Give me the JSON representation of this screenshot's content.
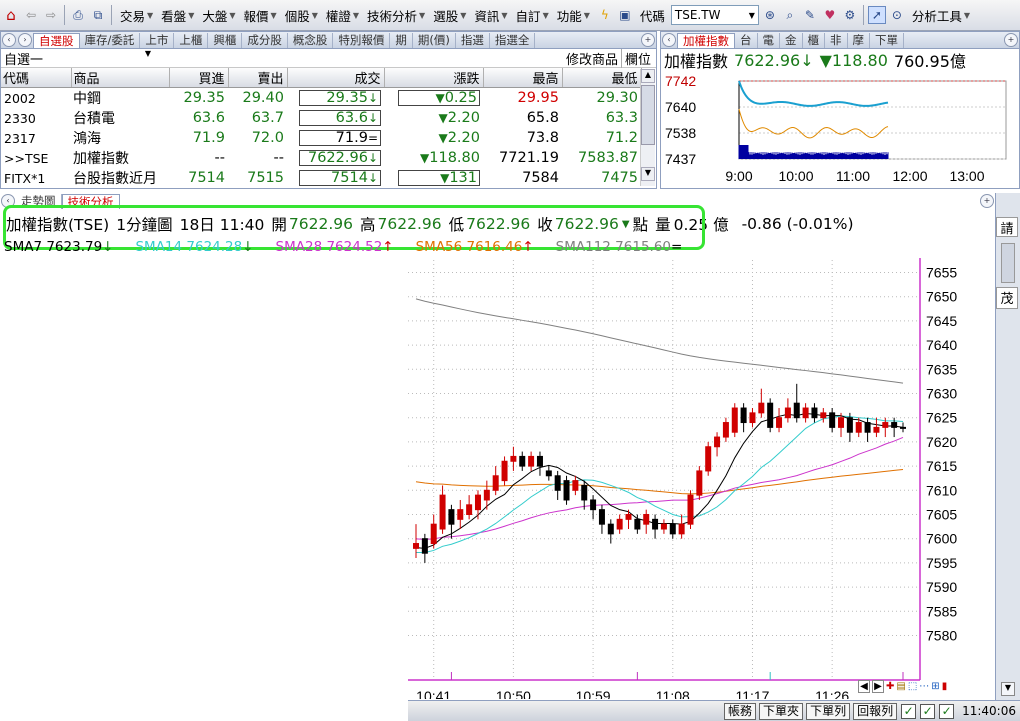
{
  "toolbar": {
    "menus": [
      "交易",
      "看盤",
      "大盤",
      "報價",
      "個股",
      "權證",
      "技術分析",
      "選股",
      "資訊",
      "自訂",
      "功能"
    ],
    "code_label": "代碼",
    "code_value": "TSE.TW",
    "analysis_tools": "分析工具"
  },
  "watchlist": {
    "tabs": [
      "自選股",
      "庫存/委託",
      "上市",
      "上櫃",
      "興櫃",
      "成分股",
      "概念股",
      "特別報價",
      "期",
      "期(價)",
      "指選",
      "指選全"
    ],
    "active_tab": "自選股",
    "list_name": "自選一",
    "edit_label": "修改商品",
    "field_label": "欄位",
    "columns": [
      "代碼",
      "商品",
      "買進",
      "賣出",
      "成交",
      "漲跌",
      "最高",
      "最低"
    ],
    "rows": [
      {
        "code": "2002",
        "name": "中鋼",
        "bid": "29.35",
        "ask": "29.40",
        "last": "29.35",
        "last_mark": "↓",
        "chg": "0.25",
        "chg_dir": "▼",
        "high": "29.95",
        "low": "29.30"
      },
      {
        "code": "2330",
        "name": "台積電",
        "bid": "63.6",
        "ask": "63.7",
        "last": "63.6",
        "last_mark": "↓",
        "chg": "2.20",
        "chg_dir": "▼",
        "high": "65.8",
        "low": "63.3"
      },
      {
        "code": "2317",
        "name": "鴻海",
        "bid": "71.9",
        "ask": "72.0",
        "last": "71.9",
        "last_mark": "=",
        "chg": "2.20",
        "chg_dir": "▼",
        "high": "73.8",
        "low": "71.2"
      },
      {
        "code": ">>TSE",
        "name": "加權指數",
        "bid": "--",
        "ask": "--",
        "last": "7622.96",
        "last_mark": "↓",
        "chg": "118.80",
        "chg_dir": "▼",
        "high": "7721.19",
        "low": "7583.87"
      },
      {
        "code": "FITX*1",
        "name": "台股指數近月",
        "bid": "7514",
        "ask": "7515",
        "last": "7514",
        "last_mark": "↓",
        "chg": "131",
        "chg_dir": "▼",
        "high": "7584",
        "low": "7475"
      }
    ]
  },
  "mini_chart": {
    "tabs": [
      "加權指數",
      "台",
      "電",
      "金",
      "櫃",
      "非",
      "摩",
      "下單"
    ],
    "active_tab": "加權指數",
    "title": "加權指數",
    "price": "7622.96",
    "price_mark": "↓",
    "change_mark": "▼",
    "change": "118.80",
    "volume": "760.95億",
    "y_ticks": [
      "7742",
      "7640",
      "7538",
      "7437"
    ],
    "x_ticks": [
      "9:00",
      "10:00",
      "11:00",
      "12:00",
      "13:00"
    ]
  },
  "main_chart": {
    "tabs": [
      "走勢圖",
      "技術分析"
    ],
    "active_tab": "技術分析",
    "quote": {
      "name": "加權指數(TSE)",
      "period": "1分鐘圖",
      "datetime": "18日 11:40",
      "open_label": "開",
      "open": "7622.96",
      "high_label": "高",
      "high": "7622.96",
      "low_label": "低",
      "low": "7622.96",
      "close_label": "收",
      "close": "7622.96",
      "close_mark": "▼",
      "unit_label": "點",
      "vol_label": "量",
      "volume": "0.25 億",
      "change": "-0.86 (-0.01%)"
    },
    "sma_legend": [
      {
        "label": "SMA7 7623.79",
        "mark": "↓",
        "color": "#000000"
      },
      {
        "label": "SMA14 7624.28",
        "mark": "↓",
        "color": "#33cccc"
      },
      {
        "label": "SMA28 7624.52",
        "mark": "↑",
        "color": "#cc33cc"
      },
      {
        "label": "SMA56 7616.46",
        "mark": "↑",
        "color": "#e07000"
      },
      {
        "label": "SMA112 7615.60",
        "mark": "=",
        "color": "#808080"
      }
    ]
  },
  "right_panel": {
    "label_top": "請",
    "label_mid": "茂"
  },
  "status_bar": {
    "buttons": [
      "帳務",
      "下單夾",
      "下單列",
      "回報列"
    ],
    "time": "11:40:06"
  },
  "colors": {
    "up": "#d00000",
    "down": "#1a7a1a",
    "highlight_box": "#37e433",
    "chart_frame": "#cc33cc"
  },
  "chart_data": {
    "type": "candlestick",
    "ylim": [
      7577,
      7658
    ],
    "y_ticks": [
      7655,
      7650,
      7645,
      7640,
      7635,
      7630,
      7625,
      7620,
      7615,
      7610,
      7605,
      7600,
      7595,
      7590,
      7585,
      7580
    ],
    "x_ticks": [
      "10:41",
      "10:50",
      "10:59",
      "11:08",
      "11:17",
      "11:26"
    ],
    "candles": [
      {
        "o": 7598,
        "c": 7599,
        "h": 7603,
        "l": 7596
      },
      {
        "o": 7600,
        "c": 7597,
        "h": 7601,
        "l": 7595
      },
      {
        "o": 7599,
        "c": 7603,
        "h": 7605,
        "l": 7598
      },
      {
        "o": 7602,
        "c": 7609,
        "h": 7611,
        "l": 7601
      },
      {
        "o": 7606,
        "c": 7603,
        "h": 7607,
        "l": 7600
      },
      {
        "o": 7604,
        "c": 7606,
        "h": 7608,
        "l": 7602
      },
      {
        "o": 7605,
        "c": 7607,
        "h": 7609,
        "l": 7604
      },
      {
        "o": 7606,
        "c": 7609,
        "h": 7610,
        "l": 7604
      },
      {
        "o": 7608,
        "c": 7610,
        "h": 7612,
        "l": 7606
      },
      {
        "o": 7610,
        "c": 7613,
        "h": 7615,
        "l": 7609
      },
      {
        "o": 7612,
        "c": 7616,
        "h": 7617,
        "l": 7611
      },
      {
        "o": 7616,
        "c": 7617,
        "h": 7619,
        "l": 7614
      },
      {
        "o": 7617,
        "c": 7615,
        "h": 7618,
        "l": 7614
      },
      {
        "o": 7615,
        "c": 7617,
        "h": 7618,
        "l": 7614
      },
      {
        "o": 7617,
        "c": 7615,
        "h": 7618,
        "l": 7613
      },
      {
        "o": 7614,
        "c": 7613,
        "h": 7615,
        "l": 7612
      },
      {
        "o": 7613,
        "c": 7610,
        "h": 7614,
        "l": 7608
      },
      {
        "o": 7612,
        "c": 7608,
        "h": 7613,
        "l": 7607
      },
      {
        "o": 7610,
        "c": 7612,
        "h": 7613,
        "l": 7609
      },
      {
        "o": 7611,
        "c": 7608,
        "h": 7612,
        "l": 7606
      },
      {
        "o": 7608,
        "c": 7606,
        "h": 7609,
        "l": 7604
      },
      {
        "o": 7606,
        "c": 7603,
        "h": 7607,
        "l": 7601
      },
      {
        "o": 7603,
        "c": 7601,
        "h": 7604,
        "l": 7599
      },
      {
        "o": 7602,
        "c": 7604,
        "h": 7605,
        "l": 7601
      },
      {
        "o": 7604,
        "c": 7605,
        "h": 7606,
        "l": 7602
      },
      {
        "o": 7604,
        "c": 7602,
        "h": 7605,
        "l": 7601
      },
      {
        "o": 7603,
        "c": 7605,
        "h": 7606,
        "l": 7601
      },
      {
        "o": 7604,
        "c": 7602,
        "h": 7605,
        "l": 7600
      },
      {
        "o": 7602,
        "c": 7603,
        "h": 7604,
        "l": 7601
      },
      {
        "o": 7603,
        "c": 7601,
        "h": 7604,
        "l": 7600
      },
      {
        "o": 7601,
        "c": 7603,
        "h": 7605,
        "l": 7600
      },
      {
        "o": 7603,
        "c": 7609,
        "h": 7610,
        "l": 7602
      },
      {
        "o": 7609,
        "c": 7614,
        "h": 7615,
        "l": 7608
      },
      {
        "o": 7614,
        "c": 7619,
        "h": 7620,
        "l": 7613
      },
      {
        "o": 7619,
        "c": 7621,
        "h": 7622,
        "l": 7617
      },
      {
        "o": 7621,
        "c": 7624,
        "h": 7625,
        "l": 7620
      },
      {
        "o": 7622,
        "c": 7627,
        "h": 7628,
        "l": 7621
      },
      {
        "o": 7627,
        "c": 7624,
        "h": 7628,
        "l": 7622
      },
      {
        "o": 7624,
        "c": 7626,
        "h": 7627,
        "l": 7623
      },
      {
        "o": 7626,
        "c": 7628,
        "h": 7631,
        "l": 7625
      },
      {
        "o": 7628,
        "c": 7623,
        "h": 7629,
        "l": 7622
      },
      {
        "o": 7623,
        "c": 7625,
        "h": 7627,
        "l": 7622
      },
      {
        "o": 7625,
        "c": 7627,
        "h": 7629,
        "l": 7624
      },
      {
        "o": 7628,
        "c": 7625,
        "h": 7632,
        "l": 7624
      },
      {
        "o": 7625,
        "c": 7627,
        "h": 7628,
        "l": 7624
      },
      {
        "o": 7627,
        "c": 7625,
        "h": 7628,
        "l": 7624
      },
      {
        "o": 7625,
        "c": 7626,
        "h": 7627,
        "l": 7624
      },
      {
        "o": 7626,
        "c": 7623,
        "h": 7627,
        "l": 7622
      },
      {
        "o": 7623,
        "c": 7625,
        "h": 7626,
        "l": 7621
      },
      {
        "o": 7625,
        "c": 7622,
        "h": 7626,
        "l": 7620
      },
      {
        "o": 7622,
        "c": 7624,
        "h": 7625,
        "l": 7621
      },
      {
        "o": 7624,
        "c": 7622,
        "h": 7625,
        "l": 7620
      },
      {
        "o": 7622,
        "c": 7623,
        "h": 7625,
        "l": 7621
      },
      {
        "o": 7623,
        "c": 7624,
        "h": 7625,
        "l": 7621
      },
      {
        "o": 7624,
        "c": 7623,
        "h": 7625,
        "l": 7621
      },
      {
        "o": 7623,
        "c": 7622.96,
        "h": 7624,
        "l": 7622
      }
    ]
  }
}
